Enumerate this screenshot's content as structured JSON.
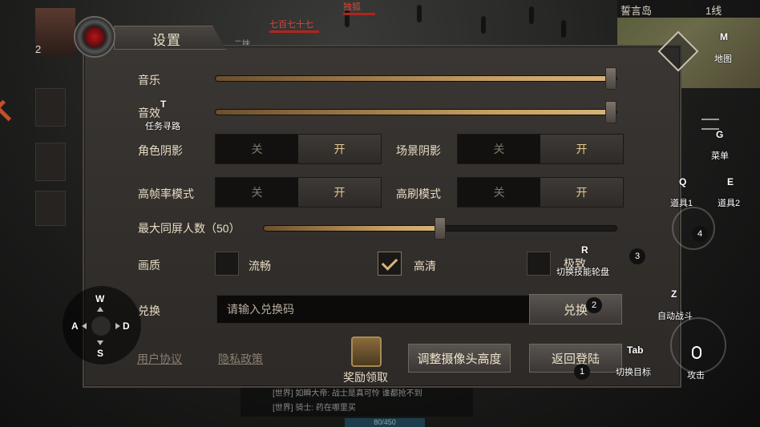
{
  "scene": {
    "location": "誓言岛",
    "line": "1线",
    "boss_name": "独狐",
    "npc_name": "七百七十七",
    "side_text": "二妹",
    "player_level_badge": "2",
    "exp_text": "80/450",
    "chat_lines": [
      "[世界] 如瞬大帝: 战士是真可怜 谁都抢不到",
      "[世界] 骑士: 药在哪里买"
    ]
  },
  "settings": {
    "title": "设置",
    "music_label": "音乐",
    "music_value": 1.0,
    "sfx_label": "音效",
    "sfx_value": 1.0,
    "char_shadow_label": "角色阴影",
    "scene_shadow_label": "场景阴影",
    "high_fps_label": "高帧率模式",
    "high_refresh_label": "高刷模式",
    "off_label": "关",
    "on_label": "开",
    "max_players_label": "最大同屏人数（50）",
    "max_players_value": 0.5,
    "quality_label": "画质",
    "quality_options": [
      {
        "label": "流畅",
        "checked": false
      },
      {
        "label": "高清",
        "checked": true
      },
      {
        "label": "极致",
        "checked": false
      }
    ],
    "redeem_label": "兑换",
    "redeem_placeholder": "请输入兑换码",
    "redeem_button": "兑换",
    "user_agreement": "用户协议",
    "privacy_policy": "隐私政策",
    "reward_label": "奖励领取",
    "camera_button": "调整摄像头高度",
    "return_login_button": "返回登陆"
  },
  "hotkeys": {
    "task_key": "T",
    "task_label": "任务寻路",
    "map_key": "M",
    "map_label": "地图",
    "menu_key": "G",
    "menu_label": "菜单",
    "item1_key": "Q",
    "item1_label": "道具1",
    "item2_key": "E",
    "item2_label": "道具2",
    "skill_wheel_key": "R",
    "skill_wheel_label": "切换技能轮盘",
    "auto_battle_key": "Z",
    "auto_battle_label": "自动战斗",
    "target_key": "Tab",
    "target_label": "切换目标",
    "attack_label": "攻击",
    "badge_1": "1",
    "badge_2": "2",
    "badge_3": "3",
    "badge_4": "4",
    "dpad_up": "W",
    "dpad_left": "A",
    "dpad_right": "D",
    "dpad_down": "S"
  },
  "colors": {
    "accent_gold": "#d9b47a",
    "panel": "#35312e",
    "on_text": "#e6c88f",
    "off_text": "#7f776c"
  }
}
